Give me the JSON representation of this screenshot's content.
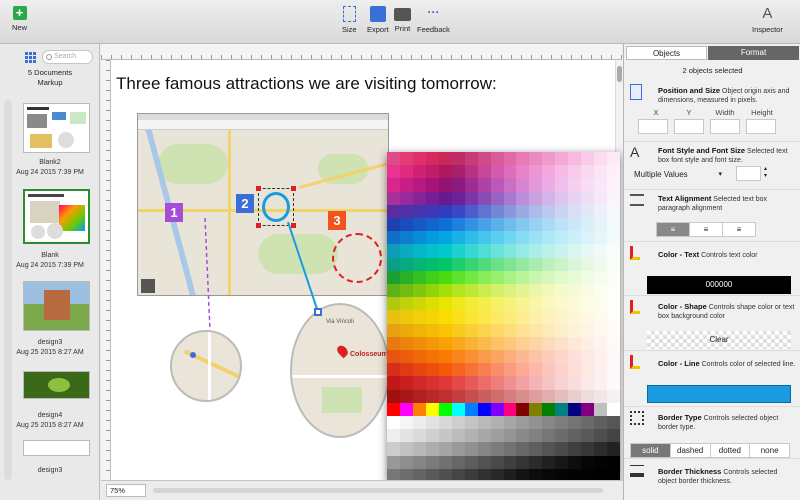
{
  "toolbar": {
    "new_label": "New",
    "size_label": "Size",
    "export_label": "Export",
    "print_label": "Print",
    "feedback_label": "Feedback",
    "inspector_label": "Inspector"
  },
  "sidebar": {
    "search_placeholder": "Search",
    "doc_count": "5 Documents",
    "doc_name": "Markup",
    "items": [
      {
        "name": "Blank2",
        "date": "Aug 24 2015 7:39 PM"
      },
      {
        "name": "Blank",
        "date": "Aug 24 2015 7:39 PM"
      },
      {
        "name": "design3",
        "date": "Aug 25 2015 8:27 AM"
      },
      {
        "name": "design4",
        "date": "Aug 25 2015 8:27 AM"
      },
      {
        "name": "design3",
        "date": ""
      }
    ]
  },
  "canvas": {
    "headline": "Three famous attractions we are visiting tomorrow:",
    "badges": [
      "1",
      "2",
      "3"
    ],
    "zoom": "75%",
    "colosseum_label": "Colosseum",
    "street_label": "Via Vincoli"
  },
  "inspector": {
    "tab_objects": "Objects",
    "tab_format": "Format",
    "selection_status": "2 objects selected",
    "position": {
      "title": "Position and Size",
      "desc": "Object origin axis and dimensions, measured in pixels.",
      "x_label": "X",
      "y_label": "Y",
      "width_label": "Width",
      "height_label": "Height"
    },
    "font": {
      "title": "Font Style and Font Size",
      "desc": "Selected text box font style and font size.",
      "font_value": "Multiple Values"
    },
    "alignment": {
      "title": "Text Alignment",
      "desc": "Selected text box paragraph alignment"
    },
    "color_text": {
      "title": "Color - Text",
      "desc": "Controls text color",
      "value": "000000"
    },
    "color_shape": {
      "title": "Color - Shape",
      "desc": "Controls shape color or text box background color",
      "value": "Clear"
    },
    "color_line": {
      "title": "Color - Line",
      "desc": "Controls color of selected line.",
      "value": "00A0E6"
    },
    "border_type": {
      "title": "Border Type",
      "desc": "Controls selected object border type.",
      "options": [
        "solid",
        "dashed",
        "dotted",
        "none"
      ]
    },
    "border_thickness": {
      "title": "Border Thickness",
      "desc": "Controls selected object border thickness."
    }
  },
  "colors": {
    "accent": "#3a6fd8",
    "badge1": "#a64dd8",
    "badge2": "#3b6fd6",
    "badge3": "#f2521c",
    "line_color": "#1a9be0",
    "selection_green": "#2e8b2e"
  },
  "palette_rows": [
    [
      "#e04a8a",
      "#e03c78",
      "#e0306a",
      "#d42a5e",
      "#c8285a",
      "#c02c66",
      "#c83a78",
      "#d04a8a",
      "#d85a9a",
      "#e06aa8",
      "#e87ab6",
      "#ec8ac0",
      "#f09acc",
      "#f4aad6",
      "#f8bae0",
      "#facae8",
      "#fcdaf0",
      "#feeaf6"
    ],
    [
      "#e8348e",
      "#e02a80",
      "#d02274",
      "#c01c68",
      "#b0185e",
      "#a8206a",
      "#b83282",
      "#c84698",
      "#d45aac",
      "#de6ebc",
      "#e882ca",
      "#ee96d4",
      "#f2a8dc",
      "#f6bae4",
      "#f8caea",
      "#fad8f0",
      "#fce4f4",
      "#fef0fa"
    ],
    [
      "#d8268c",
      "#c81e86",
      "#b81880",
      "#a6147a",
      "#941270",
      "#8c1a7e",
      "#9e2c92",
      "#ae42a6",
      "#be58b8",
      "#cc6ec6",
      "#d884d2",
      "#e29adc",
      "#eaaee4",
      "#f0c0ea",
      "#f4d0f0",
      "#f8ddf4",
      "#fae8f8",
      "#fdf2fc"
    ],
    [
      "#a8309c",
      "#982a9a",
      "#882498",
      "#781e94",
      "#681a8e",
      "#6a2296",
      "#7a36a6",
      "#8a4cb4",
      "#9a62c2",
      "#aa78ce",
      "#ba8ed8",
      "#c8a2e0",
      "#d4b4e8",
      "#dec4ee",
      "#e6d2f2",
      "#eedef6",
      "#f4e8fa",
      "#faf4fc"
    ],
    [
      "#5a2ca0",
      "#5030a8",
      "#4634b0",
      "#3c38b8",
      "#323cbe",
      "#3a48c6",
      "#4c5ccc",
      "#6072d2",
      "#7486d8",
      "#8898de",
      "#9caae4",
      "#aebae8",
      "#beC8ee",
      "#ccd4f2",
      "#d8def4",
      "#e2e8f8",
      "#ecf0fa",
      "#f6f8fc"
    ],
    [
      "#2040b0",
      "#1c4cbc",
      "#1858c6",
      "#1464d0",
      "#1070d8",
      "#2080de",
      "#3490e2",
      "#48a0e6",
      "#5cb0ea",
      "#70bcee",
      "#84c8f0",
      "#98d2f2",
      "#aadaf4",
      "#bce2f6",
      "#cce8f8",
      "#daeef8",
      "#e6f4fa",
      "#f2fafc"
    ],
    [
      "#1070c8",
      "#0c7ed2",
      "#088cd8",
      "#049ade",
      "#02a6e2",
      "#18b2e6",
      "#2ebcea",
      "#44c6ec",
      "#5acef0",
      "#70d6f2",
      "#86dcf4",
      "#9ae2f6",
      "#ace8f6",
      "#bcecf8",
      "#cceff8",
      "#daf3fa",
      "#e6f7fa",
      "#f2fbfc"
    ],
    [
      "#0e9cb8",
      "#0aaac0",
      "#06b6c6",
      "#04c0ca",
      "#02c8cc",
      "#1ed0d0",
      "#38d6d4",
      "#52dcd8",
      "#6ae2dc",
      "#80e6e0",
      "#96eae4",
      "#aaeee8",
      "#bcf0ea",
      "#ccf2ee",
      "#daf6f0",
      "#e6f8f4",
      "#f0faf8",
      "#f8fdfc"
    ],
    [
      "#0aa088",
      "#08aa80",
      "#06b478",
      "#04be70",
      "#02c668",
      "#1ece6c",
      "#38d474",
      "#52da7e",
      "#6ae088",
      "#80e494",
      "#96e8a0",
      "#aaecae",
      "#bcf0bc",
      "#ccf2ca",
      "#daf6d8",
      "#e6f8e4",
      "#f0faee",
      "#f8fdf8"
    ],
    [
      "#1ea030",
      "#28b028",
      "#34c020",
      "#40ce18",
      "#4cda12",
      "#5ee22a",
      "#72e840",
      "#86ec58",
      "#98f06e",
      "#aaf284",
      "#baf498",
      "#c8f6ac",
      "#d6f8be",
      "#e0facc",
      "#e8fad8",
      "#f0fce4",
      "#f6fdee",
      "#fbfef8"
    ],
    [
      "#60b018",
      "#70bc14",
      "#80c810",
      "#92d40c",
      "#a4de08",
      "#b2e420",
      "#bee838",
      "#caec50",
      "#d4f068",
      "#dcf280",
      "#e4f494",
      "#eaf6a8",
      "#f0f8ba",
      "#f4facA",
      "#f6fad8",
      "#f8fce4",
      "#fbfdee",
      "#fdfef8"
    ],
    [
      "#b0c810",
      "#c0d20c",
      "#ced808",
      "#dcde06",
      "#e8e404",
      "#eee81c",
      "#f2ec34",
      "#f4ee4c",
      "#f6f064",
      "#f8f27c",
      "#f8f492",
      "#faf6a8",
      "#faf8ba",
      "#fcfaca",
      "#fcfad8",
      "#fdfce4",
      "#fdfdee",
      "#fefef8"
    ],
    [
      "#e8c010",
      "#ecc80c",
      "#f0d008",
      "#f4d606",
      "#f8dc04",
      "#f8e01c",
      "#fae434",
      "#fae84c",
      "#fcea64",
      "#fcec7c",
      "#fcee92",
      "#fdf0a8",
      "#fdf2ba",
      "#fdf4ca",
      "#fef6d8",
      "#fef8e4",
      "#fefaee",
      "#fffdf8"
    ],
    [
      "#e8a010",
      "#ecaa0c",
      "#f0b408",
      "#f4bc06",
      "#f8c404",
      "#f8ca1c",
      "#facf34",
      "#fad44c",
      "#fcd964",
      "#fcde7c",
      "#fce292",
      "#fde6a8",
      "#fdeaba",
      "#fdeeca",
      "#fef2d8",
      "#fef5e4",
      "#fef8ee",
      "#fffcf8"
    ],
    [
      "#e87a10",
      "#ec840c",
      "#f08e08",
      "#f49806",
      "#f8a204",
      "#f8aa1c",
      "#fab234",
      "#faba4c",
      "#fcc264",
      "#fcc87c",
      "#fcd092",
      "#fdd6a8",
      "#fddcba",
      "#fde2ca",
      "#fee8d8",
      "#feeee4",
      "#fef4ee",
      "#fffaf8"
    ],
    [
      "#e85410",
      "#ec5e0c",
      "#f06808",
      "#f47206",
      "#f87c04",
      "#f8861c",
      "#fa9034",
      "#fa9a4c",
      "#fca464",
      "#fcae7c",
      "#fcb892",
      "#fdc2a8",
      "#fdccba",
      "#fdd6ca",
      "#fee0d8",
      "#fee8e4",
      "#fef0ee",
      "#fff8f8"
    ],
    [
      "#d83018",
      "#e03a14",
      "#e84410",
      "#ee4e0c",
      "#f45808",
      "#f66420",
      "#f87238",
      "#f88050",
      "#fa8e68",
      "#fa9c80",
      "#fcaa96",
      "#fcb8aa",
      "#fcc6bc",
      "#fdd2cc",
      "#fdded8",
      "#fee8e4",
      "#fef0ee",
      "#fff8f8"
    ],
    [
      "#c01818",
      "#c82020",
      "#d02828",
      "#d83030",
      "#e03838",
      "#e44848",
      "#e85a5a",
      "#ec6c6c",
      "#ee7e7e",
      "#f09090",
      "#f2a2a2",
      "#f4b4b4",
      "#f6c4c4",
      "#f8d2d2",
      "#fadede",
      "#fce8e8",
      "#fdf0f0",
      "#fef8f8"
    ],
    [
      "#a01010",
      "#a81818",
      "#b02020",
      "#b82828",
      "#c03030",
      "#c43e3e",
      "#c84e4e",
      "#cc5e5e",
      "#d06e6e",
      "#d47e7e",
      "#d88e8e",
      "#dc9e9e",
      "#e0aeae",
      "#e4bebe",
      "#e8cece",
      "#ecdcdc",
      "#f0e8e8",
      "#f6f2f2"
    ],
    [
      "#ff0000",
      "#ff00ff",
      "#ff8000",
      "#ffff00",
      "#00ff00",
      "#00ffff",
      "#0080ff",
      "#0000ff",
      "#8000ff",
      "#ff0080",
      "#800000",
      "#808000",
      "#008000",
      "#008080",
      "#000080",
      "#800080",
      "#c0c0c0",
      "#ffffff"
    ],
    [
      "#ffffff",
      "#f6f6f6",
      "#ececec",
      "#e2e2e2",
      "#d8d8d8",
      "#cecece",
      "#c4c4c4",
      "#bababa",
      "#b0b0b0",
      "#a6a6a6",
      "#9c9c9c",
      "#929292",
      "#888888",
      "#7e7e7e",
      "#747474",
      "#6a6a6a",
      "#606060",
      "#565656"
    ],
    [
      "#eeeeee",
      "#e4e4e4",
      "#dadada",
      "#d0d0d0",
      "#c6c6c6",
      "#bcbcbc",
      "#b2b2b2",
      "#a8a8a8",
      "#9e9e9e",
      "#949494",
      "#8a8a8a",
      "#808080",
      "#767676",
      "#6c6c6c",
      "#626262",
      "#585858",
      "#4e4e4e",
      "#444444"
    ],
    [
      "#cccccc",
      "#c2c2c2",
      "#b8b8b8",
      "#aeaeae",
      "#a4a4a4",
      "#9a9a9a",
      "#909090",
      "#868686",
      "#7c7c7c",
      "#727272",
      "#686868",
      "#5e5e5e",
      "#545454",
      "#4a4a4a",
      "#404040",
      "#363636",
      "#2c2c2c",
      "#222222"
    ],
    [
      "#999999",
      "#8f8f8f",
      "#858585",
      "#7b7b7b",
      "#717171",
      "#676767",
      "#5d5d5d",
      "#535353",
      "#494949",
      "#3f3f3f",
      "#353535",
      "#2b2b2b",
      "#212121",
      "#171717",
      "#0d0d0d",
      "#060606",
      "#030303",
      "#000000"
    ],
    [
      "#777777",
      "#6d6d6d",
      "#636363",
      "#595959",
      "#4f4f4f",
      "#454545",
      "#3b3b3b",
      "#313131",
      "#272727",
      "#1d1d1d",
      "#131313",
      "#0c0c0c",
      "#080808",
      "#050505",
      "#030303",
      "#020202",
      "#010101",
      "#000000"
    ]
  ]
}
